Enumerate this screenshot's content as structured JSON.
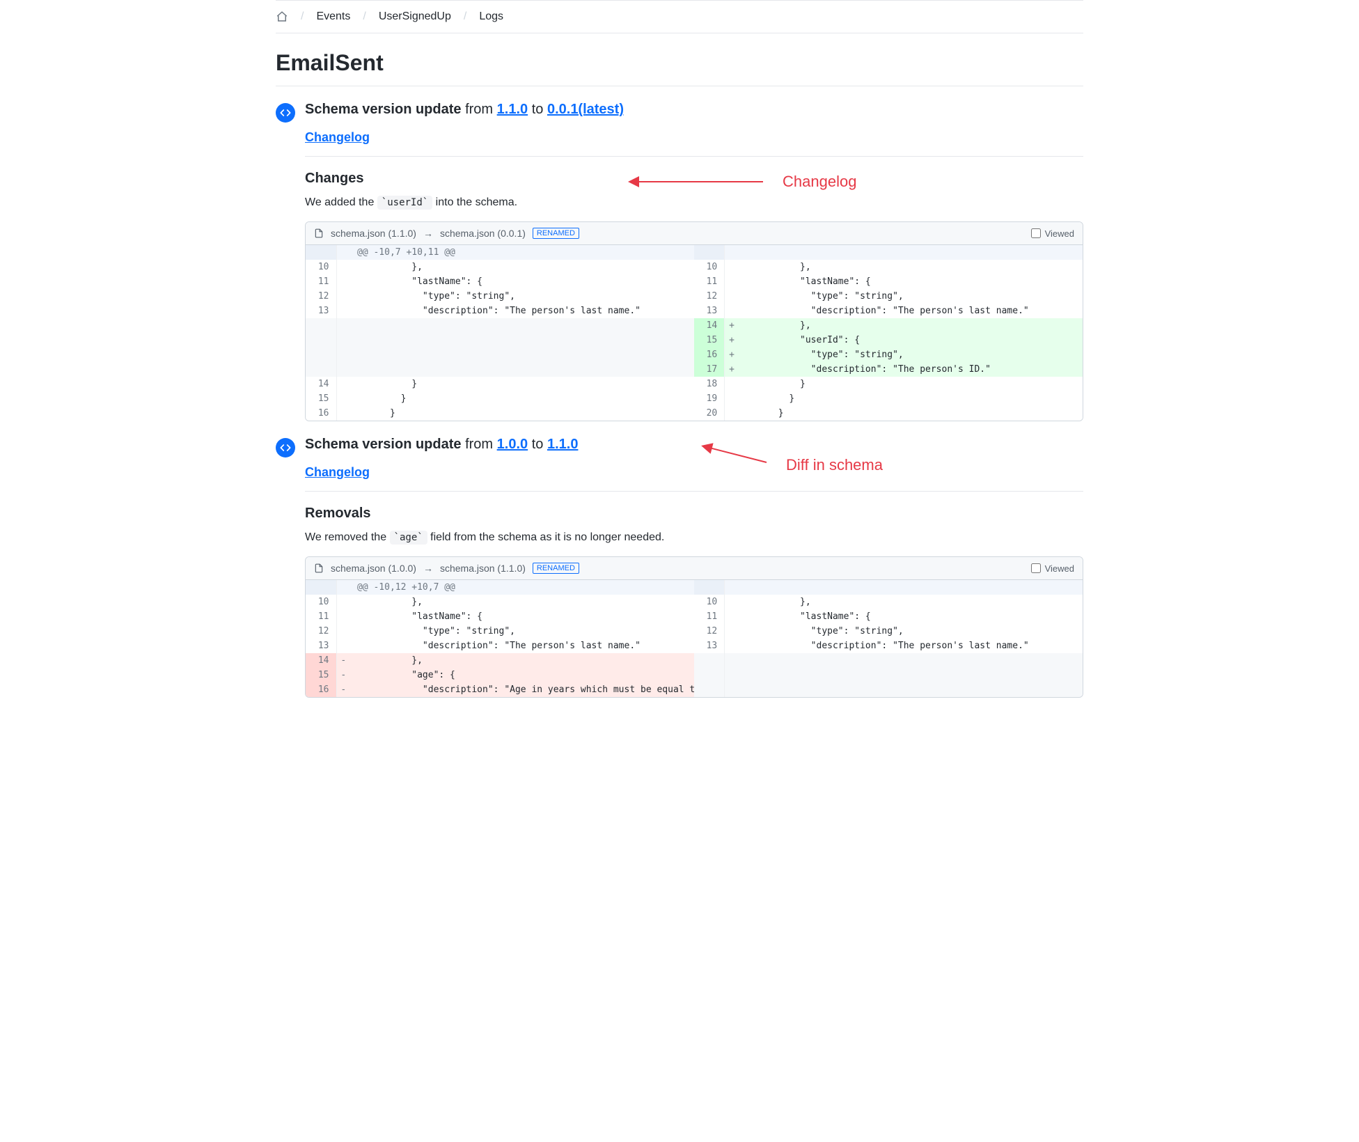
{
  "breadcrumb": [
    "Events",
    "UserSignedUp",
    "Logs"
  ],
  "page_title": "EmailSent",
  "annotations": {
    "changelog": "Changelog",
    "diff": "Diff in schema"
  },
  "sections": [
    {
      "heading_prefix": "Schema version update",
      "from_word": "from",
      "to_word": "to",
      "from_version": "1.1.0",
      "to_version": "0.0.1(latest)",
      "changelog_label": "Changelog",
      "changes_heading": "Changes",
      "changes_desc_pre": "We added the ",
      "changes_desc_code": "`userId`",
      "changes_desc_post": " into the schema.",
      "diff": {
        "file_from": "schema.json (1.1.0)",
        "file_to": "schema.json (0.0.1)",
        "badge": "RENAMED",
        "viewed_label": "Viewed",
        "hunk": "@@ -10,7 +10,11 @@",
        "rows": [
          {
            "t": "ctx",
            "l": "10",
            "r": "10",
            "code": "          },"
          },
          {
            "t": "ctx",
            "l": "11",
            "r": "11",
            "code": "          \"lastName\": {"
          },
          {
            "t": "ctx",
            "l": "12",
            "r": "12",
            "code": "            \"type\": \"string\","
          },
          {
            "t": "ctx",
            "l": "13",
            "r": "13",
            "code": "            \"description\": \"The person's last name.\""
          },
          {
            "t": "add",
            "l": "",
            "r": "14",
            "sign": "+",
            "code": "          },"
          },
          {
            "t": "add",
            "l": "",
            "r": "15",
            "sign": "+",
            "code": "          \"userId\": {"
          },
          {
            "t": "add",
            "l": "",
            "r": "16",
            "sign": "+",
            "code": "            \"type\": \"string\","
          },
          {
            "t": "add",
            "l": "",
            "r": "17",
            "sign": "+",
            "code": "            \"description\": \"The person's ID.\""
          },
          {
            "t": "ctx",
            "l": "14",
            "r": "18",
            "code": "          }"
          },
          {
            "t": "ctx",
            "l": "15",
            "r": "19",
            "code": "        }"
          },
          {
            "t": "ctx",
            "l": "16",
            "r": "20",
            "code": "      }"
          }
        ]
      }
    },
    {
      "heading_prefix": "Schema version update",
      "from_word": "from",
      "to_word": "to",
      "from_version": "1.0.0",
      "to_version": "1.1.0",
      "changelog_label": "Changelog",
      "changes_heading": "Removals",
      "changes_desc_pre": "We removed the ",
      "changes_desc_code": "`age`",
      "changes_desc_post": " field from the schema as it is no longer needed.",
      "diff": {
        "file_from": "schema.json (1.0.0)",
        "file_to": "schema.json (1.1.0)",
        "badge": "RENAMED",
        "viewed_label": "Viewed",
        "hunk": "@@ -10,12 +10,7 @@",
        "rows": [
          {
            "t": "ctx",
            "l": "10",
            "r": "10",
            "code": "          },"
          },
          {
            "t": "ctx",
            "l": "11",
            "r": "11",
            "code": "          \"lastName\": {"
          },
          {
            "t": "ctx",
            "l": "12",
            "r": "12",
            "code": "            \"type\": \"string\","
          },
          {
            "t": "ctx",
            "l": "13",
            "r": "13",
            "code": "            \"description\": \"The person's last name.\""
          },
          {
            "t": "del",
            "l": "14",
            "r": "",
            "sign": "-",
            "code": "          },"
          },
          {
            "t": "del",
            "l": "15",
            "r": "",
            "sign": "-",
            "code": "          \"age\": {"
          },
          {
            "t": "del",
            "l": "16",
            "r": "",
            "sign": "-",
            "code": "            \"description\": \"Age in years which must be equal to or gr"
          }
        ]
      }
    }
  ]
}
